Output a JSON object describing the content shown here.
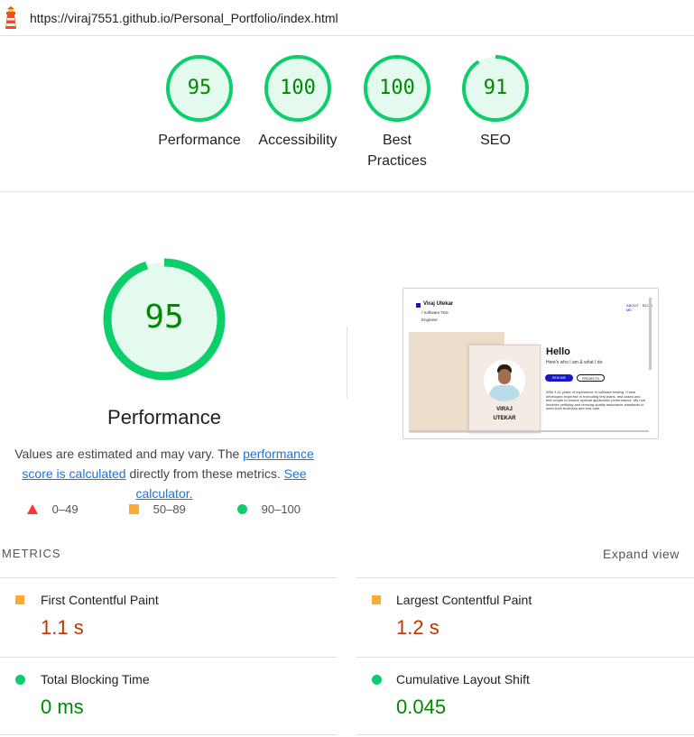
{
  "header": {
    "url": "https://viraj7551.github.io/Personal_Portfolio/index.html",
    "logo_icon": "lighthouse-icon"
  },
  "scores": [
    {
      "value": "95",
      "label": "Performance"
    },
    {
      "value": "100",
      "label": "Accessibility"
    },
    {
      "value": "100",
      "label": "Best Practices"
    },
    {
      "value": "91",
      "label": "SEO"
    }
  ],
  "main": {
    "score": "95",
    "title": "Performance",
    "note_prefix": "Values are estimated and may vary. The ",
    "note_link1": "performance score is calculated",
    "note_mid": " directly from these metrics. ",
    "note_link2": "See calculator."
  },
  "legend": [
    {
      "icon": "triangle-icon",
      "color": "#ff3333",
      "label": "0–49"
    },
    {
      "icon": "square-icon",
      "color": "#ffaa33",
      "label": "50–89"
    },
    {
      "icon": "circle-icon",
      "color": "#0cce6b",
      "label": "90–100"
    }
  ],
  "screenshot": {
    "brand": "Viraj Utekar",
    "subtitle": "/ Software Test Engineer",
    "nav1": "ABOUT ME",
    "nav2": "BLOG",
    "hello": "Hello",
    "tagline": "Here's who I am & what I do",
    "btn1": "RESUME",
    "btn2": "PROJECTS",
    "name1": "VIRAJ",
    "name2": "UTEKAR",
    "bio": "With 3.11 years of experience in software testing, I have developed expertise in executing test plans, test cases and test scripts to ensure optimal application performance. My role involves verifying and revising quality assurance standards to meet both business and end-user"
  },
  "metrics": {
    "title": "METRICS",
    "expand": "Expand view",
    "items": [
      {
        "name": "First Contentful Paint",
        "value": "1.1 s",
        "icon": "square-icon",
        "color": "#c33300"
      },
      {
        "name": "Largest Contentful Paint",
        "value": "1.2 s",
        "icon": "square-icon",
        "color": "#c33300"
      },
      {
        "name": "Total Blocking Time",
        "value": "0 ms",
        "icon": "circle-icon",
        "color": "#008800"
      },
      {
        "name": "Cumulative Layout Shift",
        "value": "0.045",
        "icon": "circle-icon",
        "color": "#008800"
      }
    ]
  },
  "colors": {
    "pass": "#0cce6b",
    "pass_bg": "#e5faef",
    "pass_text": "#008800",
    "average": "#ffaa33",
    "fail": "#ff3333"
  }
}
